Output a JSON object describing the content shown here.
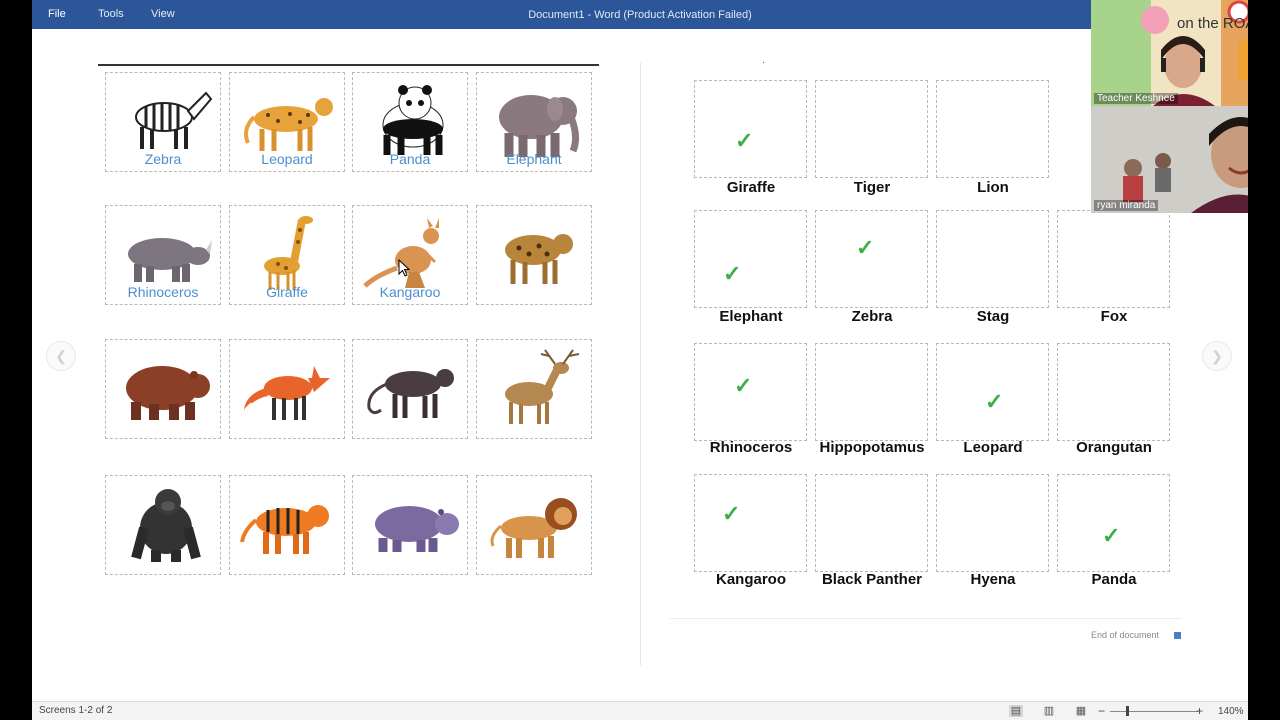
{
  "titlebar": {
    "menu": [
      "File",
      "Tools",
      "View"
    ],
    "window_title": "Document1 - Word (Product Activation Failed)"
  },
  "left_page": {
    "cards": [
      {
        "animal": "zebra",
        "label": "Zebra"
      },
      {
        "animal": "leopard",
        "label": "Leopard"
      },
      {
        "animal": "panda",
        "label": "Panda"
      },
      {
        "animal": "elephant",
        "label": "Elephant"
      },
      {
        "animal": "rhinoceros",
        "label": "Rhinoceros"
      },
      {
        "animal": "giraffe",
        "label": "Giraffe"
      },
      {
        "animal": "kangaroo",
        "label": "Kangaroo"
      },
      {
        "animal": "hyena",
        "label": ""
      },
      {
        "animal": "bear",
        "label": ""
      },
      {
        "animal": "fox",
        "label": ""
      },
      {
        "animal": "black-panther",
        "label": ""
      },
      {
        "animal": "stag",
        "label": ""
      },
      {
        "animal": "gorilla",
        "label": ""
      },
      {
        "animal": "tiger",
        "label": ""
      },
      {
        "animal": "hippopotamus",
        "label": ""
      },
      {
        "animal": "lion",
        "label": ""
      }
    ]
  },
  "right_page": {
    "stray_mark": ".",
    "answers": [
      {
        "label": "Giraffe",
        "checked": true
      },
      {
        "label": "Tiger",
        "checked": false
      },
      {
        "label": "Lion",
        "checked": false
      },
      {
        "label": "",
        "checked": false
      },
      {
        "label": "Elephant",
        "checked": true
      },
      {
        "label": "Zebra",
        "checked": true
      },
      {
        "label": "Stag",
        "checked": false
      },
      {
        "label": "Fox",
        "checked": false
      },
      {
        "label": "Rhinoceros",
        "checked": true
      },
      {
        "label": "Hippopotamus",
        "checked": false
      },
      {
        "label": "Leopard",
        "checked": true
      },
      {
        "label": "Orangutan",
        "checked": false
      },
      {
        "label": "Kangaroo",
        "checked": true
      },
      {
        "label": "Black Panther",
        "checked": false
      },
      {
        "label": "Hyena",
        "checked": false
      },
      {
        "label": "Panda",
        "checked": true
      }
    ],
    "check_glyph": "✓",
    "end_of_document": "End of document"
  },
  "statusbar": {
    "screens": "Screens 1-2 of 2",
    "zoom_out": "−",
    "zoom_in": "+",
    "zoom": "140%"
  },
  "video": {
    "teacher_name": "Teacher Keshnee",
    "teacher_sign_text": "on the ROAD",
    "student_name": "ryan miranda"
  },
  "colors": {
    "titlebar": "#2b579a",
    "label_blue": "#4a8fcf",
    "check_green": "#3cb043"
  },
  "icons": {
    "prev": "chevron-left-icon",
    "next": "chevron-right-icon",
    "read_mode": "book-icon",
    "print_layout": "page-icon",
    "web_layout": "web-icon"
  }
}
